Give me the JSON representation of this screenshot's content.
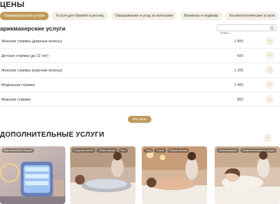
{
  "header": {
    "title": "ЦЕНЫ"
  },
  "tabs": [
    {
      "label": "Парикмахерские услуги",
      "active": true
    },
    {
      "label": "Услуги для бровей и ресниц",
      "active": false
    },
    {
      "label": "Окрашивание и уход за волосами",
      "active": false
    },
    {
      "label": "Маникюр и педикюр",
      "active": false
    },
    {
      "label": "Косметологические услуги",
      "active": false
    }
  ],
  "section": {
    "title": "арикмахерские услуги",
    "search_placeholder": "Поиск..."
  },
  "prices": [
    {
      "name": "Женская стрижка (длинные волосы)",
      "price": "1 800"
    },
    {
      "name": "Детская стрижка (до 12 лет)",
      "price": "600"
    },
    {
      "name": "Женская стрижка (короткие волосы)",
      "price": "1 200"
    },
    {
      "name": "Модельная стрижка",
      "price": "1 400"
    },
    {
      "name": "Мужская стрижка",
      "price": "800"
    }
  ],
  "all_prices_label": "Все цены",
  "extra": {
    "title": "ДОПОЛНИТЕЛЬНЫЕ УСЛУГИ",
    "cards": [
      {
        "tags": [
          "Вертикальный солярий"
        ]
      },
      {
        "tags": [
          "Моделирование",
          "Обертывание",
          "Тело"
        ]
      },
      {
        "tags": [
          "Тело",
          "Спина",
          "Общий массаж"
        ]
      },
      {
        "tags": [
          "Омолаживание",
          "Косметологические услуги"
        ]
      }
    ]
  },
  "colors": {
    "accent": "#c09a5b",
    "tab_bg": "#f4efe6",
    "arrow_bg": "#f5efe4"
  },
  "icons": {
    "row_arrow": "arrow-right-icon",
    "search": "search-icon"
  }
}
